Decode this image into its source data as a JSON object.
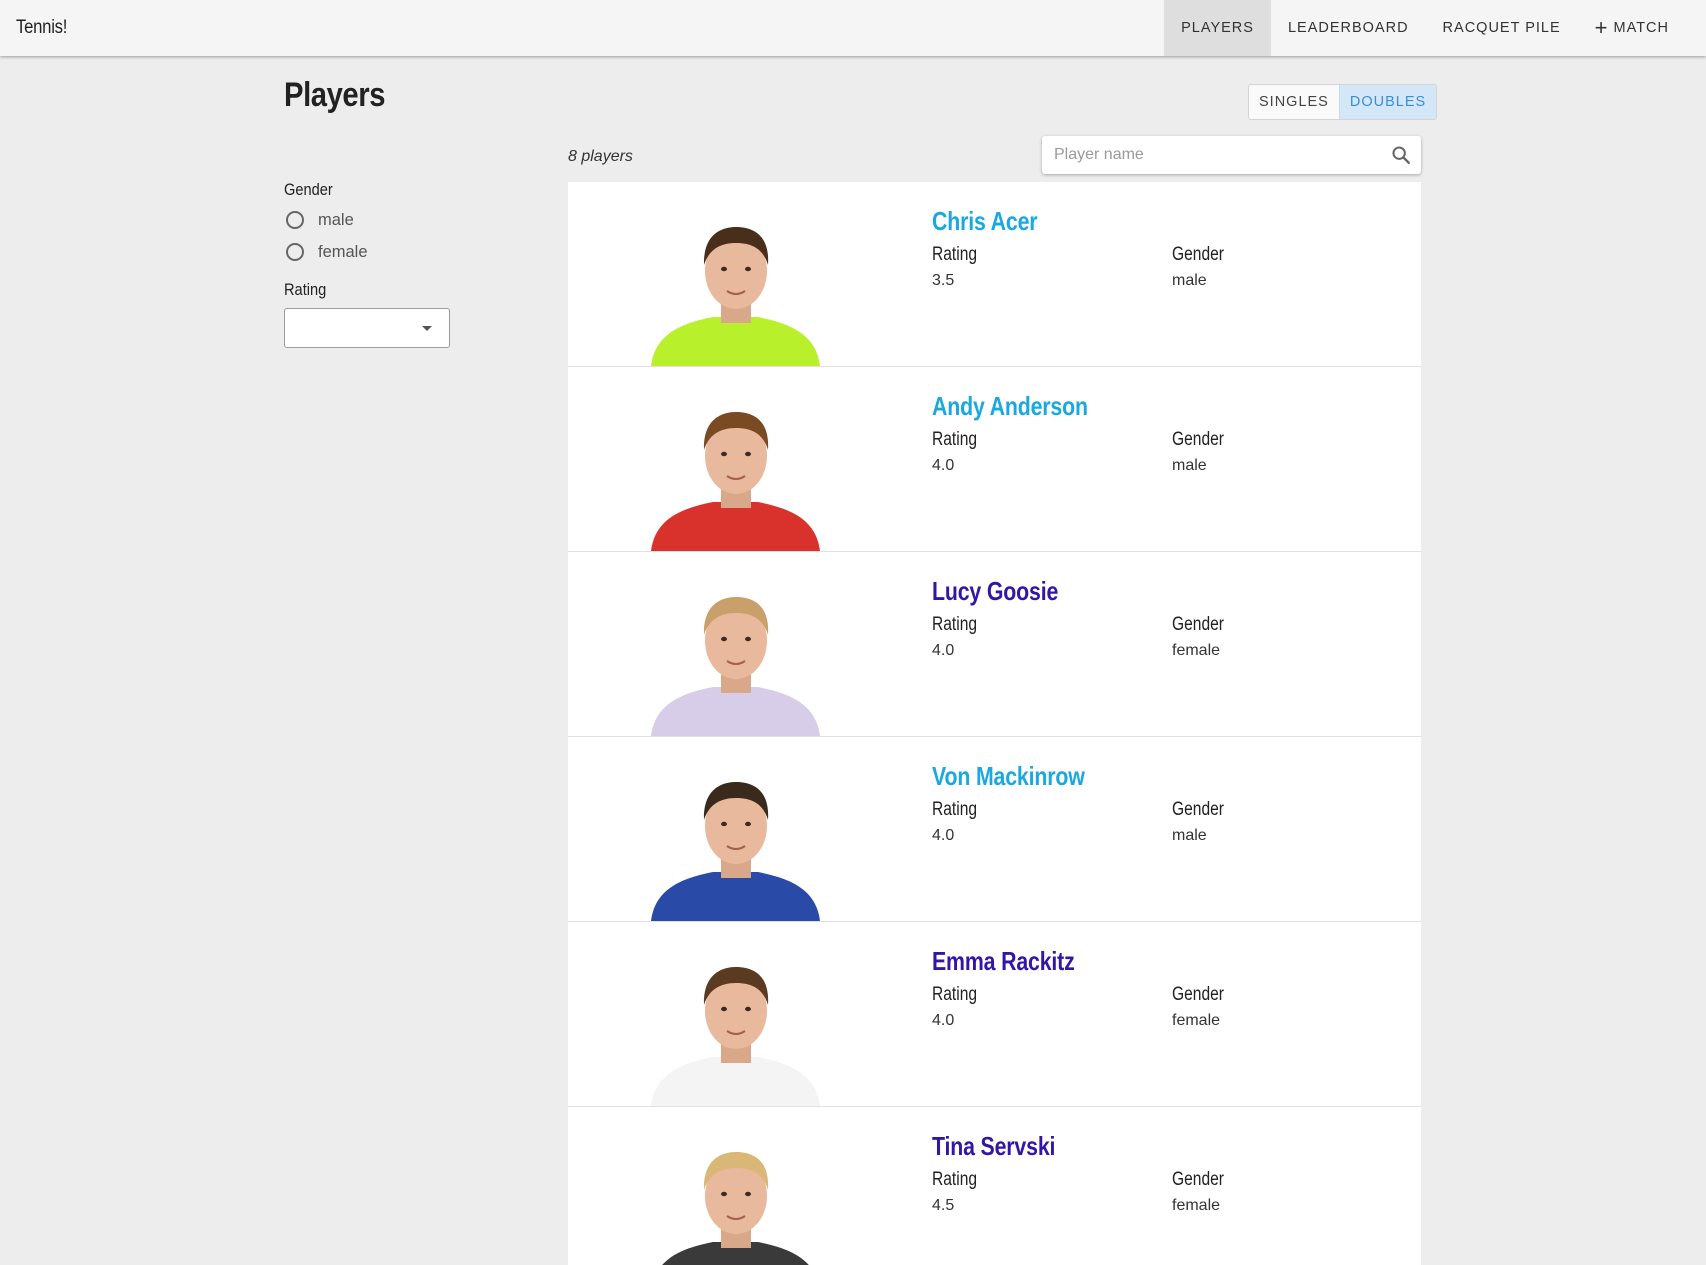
{
  "app": {
    "title": "Tennis!"
  },
  "nav": {
    "items": [
      {
        "label": "PLAYERS",
        "active": true
      },
      {
        "label": "LEADERBOARD",
        "active": false
      },
      {
        "label": "RACQUET PILE",
        "active": false
      },
      {
        "label": "MATCH",
        "icon": "plus-icon",
        "active": false
      }
    ]
  },
  "page": {
    "title": "Players"
  },
  "mode_toggle": {
    "singles": "SINGLES",
    "doubles": "DOUBLES",
    "selected": "doubles"
  },
  "filters": {
    "gender_label": "Gender",
    "gender_options": [
      "male",
      "female"
    ],
    "rating_label": "Rating",
    "rating_value": ""
  },
  "list": {
    "count_text": "8 players"
  },
  "search": {
    "placeholder": "Player name",
    "value": ""
  },
  "labels": {
    "rating": "Rating",
    "gender": "Gender"
  },
  "players": [
    {
      "name": "Chris Acer",
      "rating": "3.5",
      "gender": "male",
      "name_color": "#1aa8e0",
      "shirt": "#b8f02c",
      "hair": "#4a2e1c"
    },
    {
      "name": "Andy Anderson",
      "rating": "4.0",
      "gender": "male",
      "name_color": "#1aa8e0",
      "shirt": "#d9322c",
      "hair": "#7a4a22"
    },
    {
      "name": "Lucy Goosie",
      "rating": "4.0",
      "gender": "female",
      "name_color": "#3316a8",
      "shirt": "#d8cde8",
      "hair": "#c9a06a"
    },
    {
      "name": "Von Mackinrow",
      "rating": "4.0",
      "gender": "male",
      "name_color": "#1aa8e0",
      "shirt": "#2a4aa8",
      "hair": "#3a2a1c"
    },
    {
      "name": "Emma Rackitz",
      "rating": "4.0",
      "gender": "female",
      "name_color": "#3316a8",
      "shirt": "#f4f4f4",
      "hair": "#5a3a20"
    },
    {
      "name": "Tina Servski",
      "rating": "4.5",
      "gender": "female",
      "name_color": "#3316a8",
      "shirt": "#3a3a3a",
      "hair": "#d9b877"
    }
  ],
  "colors": {
    "active_tab_bg": "#dedede",
    "toggle_selected_bg": "#d3e7f8",
    "toggle_selected_text": "#3a8fd4"
  }
}
